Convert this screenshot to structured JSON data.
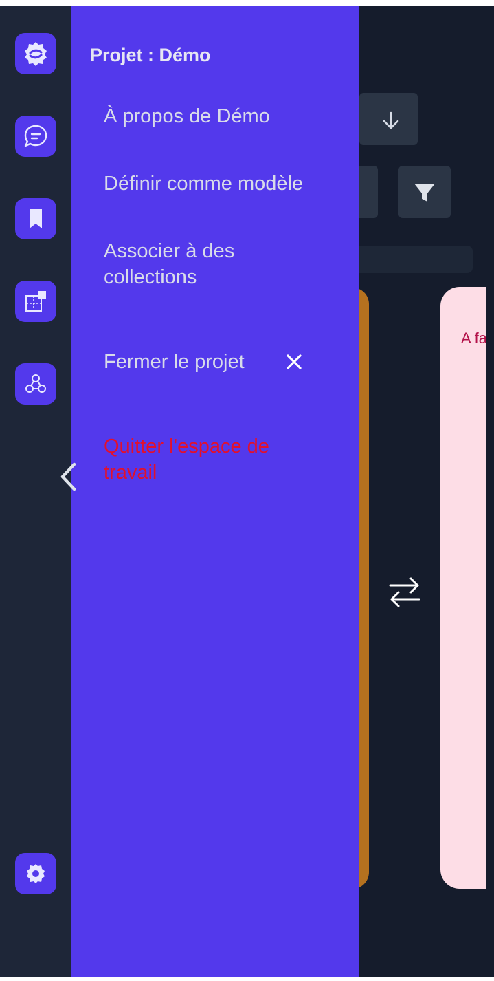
{
  "drawer": {
    "title": "Projet : Démo",
    "items": [
      {
        "label": "À propos de Démo"
      },
      {
        "label": "Définir comme modèle"
      },
      {
        "label": "Associer à des collections"
      },
      {
        "label": "Fermer le projet"
      },
      {
        "label": "Quitter l'espace de travail"
      }
    ]
  },
  "rail": {
    "icons": [
      "app-logo-icon",
      "chat-icon",
      "bookmark-icon",
      "puzzle-icon",
      "graph-nodes-icon",
      "settings-icon"
    ]
  },
  "background": {
    "pink_card_text": "A fa"
  },
  "colors": {
    "drawer_bg": "#5339ec",
    "rail_bg": "#1e2638",
    "page_bg": "#151c2c",
    "danger": "#e3102c",
    "orange_card": "#b5711f",
    "pink_card": "#fddde6"
  }
}
